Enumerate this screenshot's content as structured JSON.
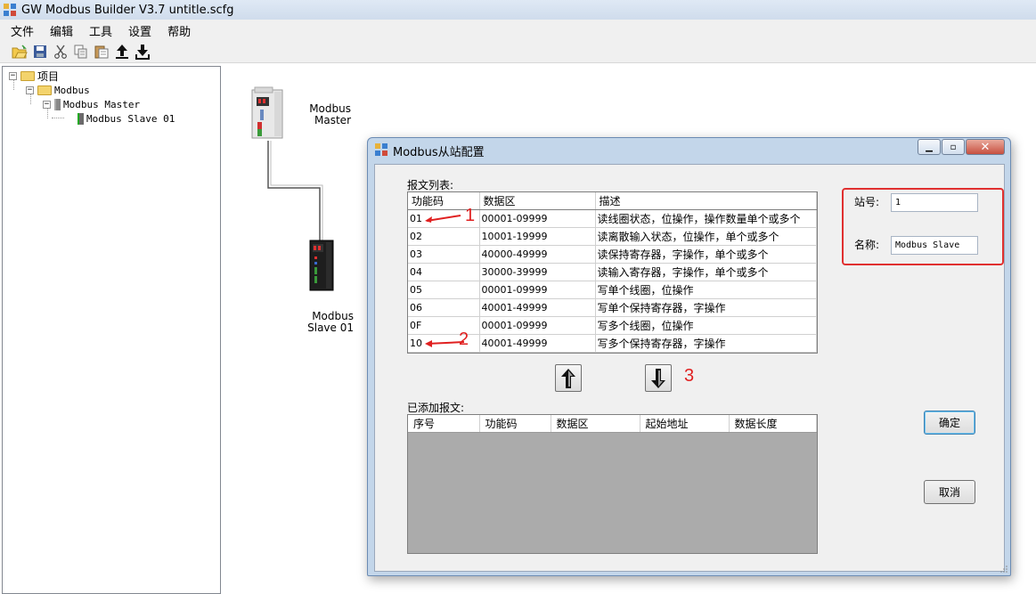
{
  "window": {
    "title": "GW Modbus Builder V3.7   untitle.scfg"
  },
  "menu": {
    "items": [
      "文件",
      "编辑",
      "工具",
      "设置",
      "帮助"
    ]
  },
  "toolbar": {
    "icons": [
      "open-icon",
      "save-icon",
      "cut-icon",
      "copy-icon",
      "paste-icon",
      "upload-icon",
      "download-icon"
    ]
  },
  "tree": {
    "root": "项目",
    "modbus": "Modbus",
    "master": "Modbus Master",
    "slave": "Modbus Slave  01"
  },
  "canvas": {
    "master_label_1": "Modbus",
    "master_label_2": "Master",
    "slave_label_1": "Modbus",
    "slave_label_2": "Slave  01"
  },
  "dialog": {
    "title": "Modbus从站配置",
    "msg_list_label": "报文列表:",
    "columns": [
      "功能码",
      "数据区",
      "描述"
    ],
    "rows": [
      [
        "01",
        "00001-09999",
        "读线圈状态，位操作，操作数量单个或多个"
      ],
      [
        "02",
        "10001-19999",
        "读离散输入状态，位操作，单个或多个"
      ],
      [
        "03",
        "40000-49999",
        "读保持寄存器，字操作，单个或多个"
      ],
      [
        "04",
        "30000-39999",
        "读输入寄存器，字操作，单个或多个"
      ],
      [
        "05",
        "00001-09999",
        "写单个线圈，位操作"
      ],
      [
        "06",
        "40001-49999",
        "写单个保持寄存器，字操作"
      ],
      [
        "0F",
        "00001-09999",
        "写多个线圈，位操作"
      ],
      [
        "10",
        "40001-49999",
        "写多个保持寄存器，字操作"
      ]
    ],
    "added_label": "已添加报文:",
    "added_columns": [
      "序号",
      "功能码",
      "数据区",
      "起始地址",
      "数据长度"
    ],
    "station_label": "站号:",
    "station_value": "1",
    "name_label": "名称:",
    "name_value": "Modbus Slave",
    "ok_label": "确定",
    "cancel_label": "取消",
    "annotations": [
      "1",
      "2",
      "3"
    ],
    "annotation_color": "#e02020"
  }
}
